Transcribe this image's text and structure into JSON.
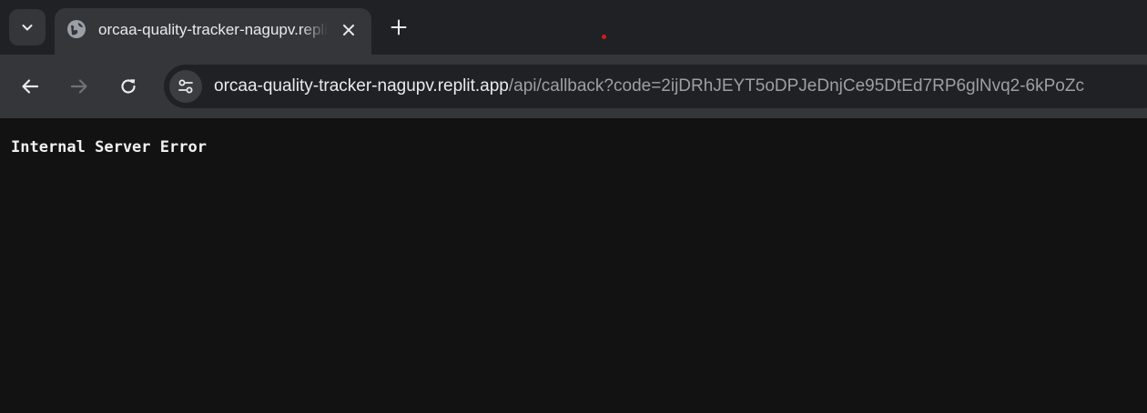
{
  "tabstrip": {
    "tab_search_icon": "chevron-down-icon",
    "active_tab": {
      "title": "orcaa-quality-tracker-nagupv.replit.app/api/callback",
      "favicon": "globe-icon",
      "close_icon": "close-icon"
    },
    "new_tab_icon": "plus-icon"
  },
  "toolbar": {
    "back_icon": "back-arrow-icon",
    "forward_icon": "forward-arrow-icon",
    "reload_icon": "reload-icon",
    "site_info_icon": "tune-icon",
    "url": {
      "host": "orcaa-quality-tracker-nagupv.replit.app",
      "path": "/api/callback?code=2ijDRhJEYT5oDPJeDnjCe95DtEd7RP6glNvq2-6kPoZc"
    }
  },
  "page": {
    "body_text": "Internal Server Error"
  },
  "colors": {
    "tabstrip_bg": "#202124",
    "tab_bg": "#35363a",
    "toolbar_bg": "#35363a",
    "omnibox_bg": "#202124",
    "page_bg": "#121212",
    "text_primary": "#e8eaed",
    "text_secondary": "#9aa0a6"
  }
}
